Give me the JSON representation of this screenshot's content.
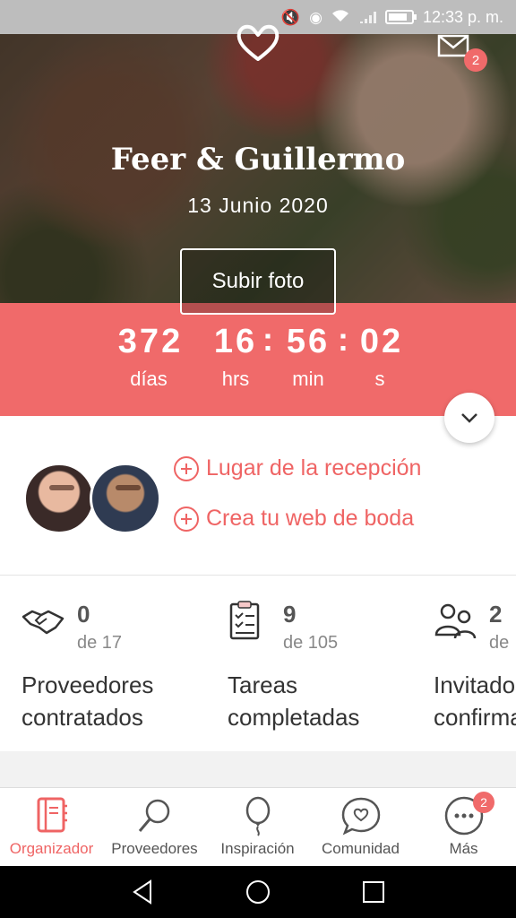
{
  "status_bar": {
    "time": "12:33 p. m."
  },
  "hero": {
    "couple_name": "Feer & Guillermo",
    "date": "13 Junio 2020",
    "upload_button": "Subir foto",
    "mail_badge": "2"
  },
  "countdown": {
    "days": "372",
    "days_label": "días",
    "hours": "16",
    "hours_label": "hrs",
    "minutes": "56",
    "minutes_label": "min",
    "seconds": "02",
    "seconds_label": "s"
  },
  "actions": {
    "reception": "Lugar de la recepción",
    "website": "Crea tu web de boda"
  },
  "stats": [
    {
      "count": "0",
      "total": "de 17",
      "title_line1": "Proveedores",
      "title_line2": "contratados"
    },
    {
      "count": "9",
      "total": "de 105",
      "title_line1": "Tareas",
      "title_line2": "completadas"
    },
    {
      "count": "2",
      "total": "de",
      "title_line1": "Invitados",
      "title_line2": "confirmados"
    }
  ],
  "bottom_nav": [
    {
      "label": "Organizador",
      "icon": "notebook-icon",
      "active": true
    },
    {
      "label": "Proveedores",
      "icon": "search-icon"
    },
    {
      "label": "Inspiración",
      "icon": "balloon-icon"
    },
    {
      "label": "Comunidad",
      "icon": "chat-heart-icon"
    },
    {
      "label": "Más",
      "icon": "more-icon",
      "badge": "2"
    }
  ],
  "colors": {
    "accent": "#f06a6a",
    "status_bar": "#bdbdbd"
  }
}
